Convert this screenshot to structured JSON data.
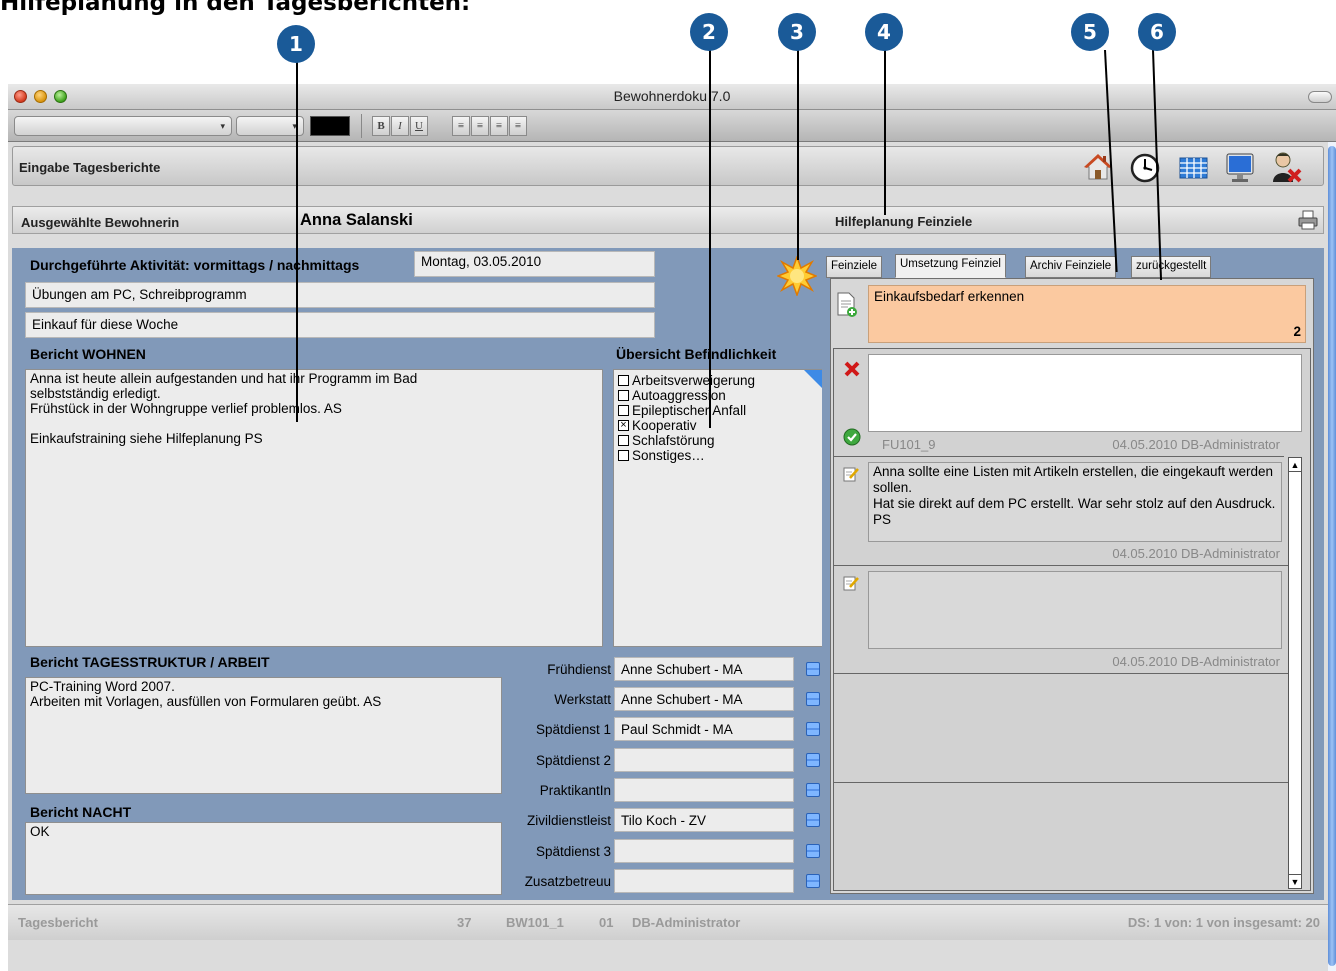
{
  "doc_heading": "Hilfeplanung in den Tagesberichten:",
  "markers": [
    "1",
    "2",
    "3",
    "4",
    "5",
    "6"
  ],
  "window": {
    "title": "Bewohnerdoku 7.0"
  },
  "formatbar": {
    "bold": "B",
    "italic": "I",
    "underline": "U"
  },
  "header": {
    "title": "Eingabe Tagesberichte",
    "icons": [
      "home-icon",
      "clock-icon",
      "calendar-grid-icon",
      "monitor-icon",
      "user-remove-icon"
    ]
  },
  "resident": {
    "label": "Ausgewählte Bewohnerin",
    "name": "Anna Salanski",
    "plan_label": "Hilfeplanung Feinziele"
  },
  "activity": {
    "label": "Durchgeführte Aktivität: vormittags / nachmittags",
    "date": "Montag, 03.05.2010",
    "morning": "Übungen am PC, Schreibprogramm",
    "afternoon": "Einkauf für diese Woche"
  },
  "bericht_wohnen": {
    "label": "Bericht WOHNEN",
    "lines": [
      "Anna ist heute allein aufgestanden und hat ihr Programm im Bad",
      "selbstständig erledigt.",
      "Frühstück in der Wohngruppe verlief problemlos. AS",
      "",
      "Einkaufstraining siehe Hilfeplanung PS"
    ]
  },
  "befindlichkeit": {
    "label": "Übersicht Befindlichkeit",
    "items": [
      {
        "label": "Arbeitsverweigerung",
        "checked": false
      },
      {
        "label": "Autoaggression",
        "checked": false
      },
      {
        "label": "Epileptischer Anfall",
        "checked": false
      },
      {
        "label": "Kooperativ",
        "checked": true
      },
      {
        "label": "Schlafstörung",
        "checked": false
      },
      {
        "label": "Sonstiges…",
        "checked": false
      }
    ]
  },
  "bericht_tagesstruktur": {
    "label": "Bericht TAGESSTRUKTUR / ARBEIT",
    "lines": [
      "PC-Training Word 2007.",
      "Arbeiten mit Vorlagen, ausfüllen von Formularen geübt. AS"
    ]
  },
  "bericht_nacht": {
    "label": "Bericht NACHT",
    "text": "OK"
  },
  "staff": [
    {
      "label": "Frühdienst",
      "value": "Anne Schubert - MA"
    },
    {
      "label": "Werkstatt",
      "value": "Anne Schubert - MA"
    },
    {
      "label": "Spätdienst 1",
      "value": "Paul Schmidt - MA"
    },
    {
      "label": "Spätdienst 2",
      "value": ""
    },
    {
      "label": "PraktikantIn",
      "value": ""
    },
    {
      "label": "Zivildienstleist",
      "value": "Tilo Koch - ZV"
    },
    {
      "label": "Spätdienst 3",
      "value": ""
    },
    {
      "label": "Zusatzbetreuu",
      "value": ""
    }
  ],
  "tabs": [
    "Feinziele",
    "Umsetzung Feinziel",
    "Archiv Feinziele",
    "zurückgestellt"
  ],
  "feinziel": {
    "title": "Einkaufsbedarf erkennen",
    "count": "2"
  },
  "entries": [
    {
      "text": "",
      "code": "FU101_9",
      "meta": "04.05.2010 DB-Administrator"
    },
    {
      "text": "Anna sollte eine Listen mit Artikeln erstellen, die eingekauft werden sollen.\nHat sie direkt auf dem PC erstellt. War sehr stolz auf den Ausdruck. PS",
      "meta": "04.05.2010 DB-Administrator"
    },
    {
      "text": "",
      "meta": "04.05.2010 DB-Administrator"
    }
  ],
  "status": {
    "left": "Tagesbericht",
    "num": "37",
    "code": "BW101_1",
    "num2": "01",
    "user": "DB-Administrator",
    "right": "DS: 1 von: 1 von insgesamt: 20"
  },
  "colors": {
    "panel_blue": "#8199b9",
    "marker_blue": "#1a5a98",
    "feinziel_orange": "#fbc9a0"
  }
}
